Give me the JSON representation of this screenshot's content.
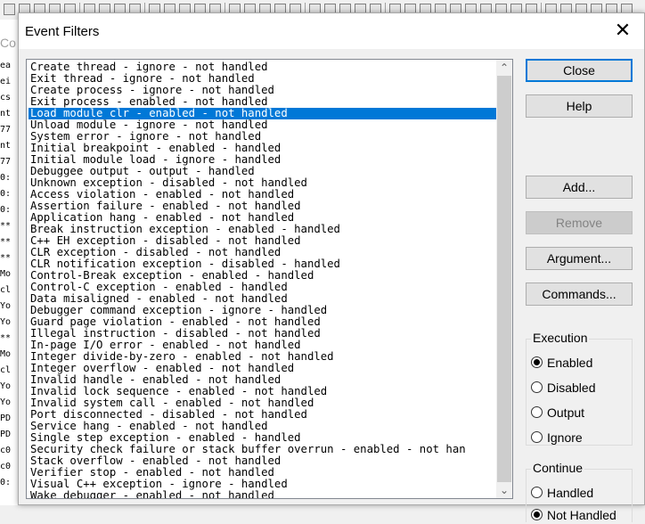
{
  "dialog": {
    "title": "Event Filters",
    "close_glyph": "✕"
  },
  "events": [
    "Create thread - ignore - not handled",
    "Exit thread - ignore - not handled",
    "Create process - ignore - not handled",
    "Exit process - enabled - not handled",
    "Load module clr - enabled - not handled",
    "Unload module - ignore - not handled",
    "System error - ignore - not handled",
    "Initial breakpoint - enabled - handled",
    "Initial module load - ignore - handled",
    "Debuggee output - output - handled",
    "Unknown exception - disabled - not handled",
    "Access violation - enabled - not handled",
    "Assertion failure - enabled - not handled",
    "Application hang - enabled - not handled",
    "Break instruction exception - enabled - handled",
    "C++ EH exception - disabled - not handled",
    "CLR exception - disabled - not handled",
    "CLR notification exception - disabled - handled",
    "Control-Break exception - enabled - handled",
    "Control-C exception - enabled - handled",
    "Data misaligned - enabled - not handled",
    "Debugger command exception - ignore - handled",
    "Guard page violation - enabled - not handled",
    "Illegal instruction - disabled - not handled",
    "In-page I/O error - enabled - not handled",
    "Integer divide-by-zero - enabled - not handled",
    "Integer overflow - enabled - not handled",
    "Invalid handle - enabled - not handled",
    "Invalid lock sequence - enabled - not handled",
    "Invalid system call - enabled - not handled",
    "Port disconnected - disabled - not handled",
    "Service hang - enabled - not handled",
    "Single step exception - enabled - handled",
    "Security check failure or stack buffer overrun - enabled - not han",
    "Stack overflow - enabled - not handled",
    "Verifier stop - enabled - not handled",
    "Visual C++ exception - ignore - handled",
    "Wake debugger - enabled - not handled"
  ],
  "selected_index": 4,
  "buttons": {
    "close": "Close",
    "help": "Help",
    "add": "Add...",
    "remove": "Remove",
    "argument": "Argument...",
    "commands": "Commands..."
  },
  "execution": {
    "label": "Execution",
    "options": [
      "Enabled",
      "Disabled",
      "Output",
      "Ignore"
    ],
    "selected": "Enabled"
  },
  "continue": {
    "label": "Continue",
    "options": [
      "Handled",
      "Not Handled"
    ],
    "selected": "Not Handled"
  },
  "background": {
    "side_label": "Co",
    "cmd_lines": [
      "ea",
      "ei",
      "cs",
      "nt",
      "77",
      "nt",
      "77",
      "0:",
      "0:",
      "0:",
      "**",
      "**",
      "**",
      "Mo",
      "cl",
      "Yo",
      "Yo",
      "**",
      "Mo",
      "cl",
      "Yo",
      "Yo",
      "PD",
      "PD",
      "c0",
      "c0",
      "0:"
    ]
  },
  "colors": {
    "selection": "#0078d7",
    "default_button_border": "#0078d7"
  }
}
